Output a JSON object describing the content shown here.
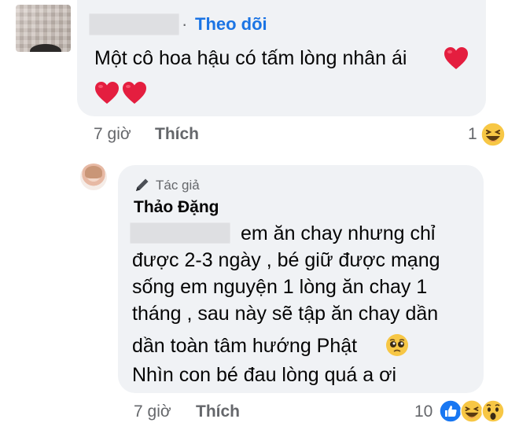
{
  "comment1": {
    "follow_dot": "·",
    "follow_label": "Theo dõi",
    "text": "Một cô hoa hậu có tấm lòng nhân ái",
    "time": "7 giờ",
    "like_label": "Thích",
    "reaction_count": "1"
  },
  "reply": {
    "author_tag": "Tác giả",
    "author_name": "Thảo Đặng",
    "line1": "em ăn chay nhưng chỉ",
    "line2": "được 2-3 ngày , bé giữ được mạng",
    "line3": "sống em nguyện 1 lòng ăn chay 1",
    "line4": "tháng , sau này sẽ tập ăn chay dần",
    "line5": "dần toàn tâm hướng Phật",
    "line6": "Nhìn con bé đau lòng quá a ơi",
    "time": "7 giờ",
    "like_label": "Thích",
    "reaction_count": "10"
  },
  "colors": {
    "bubble": "#f0f2f5",
    "link_blue": "#1b74e4",
    "meta_gray": "#65676b",
    "heart_red": "#e41e3f",
    "like_blue": "#1877f2",
    "emoji_yellow": "#f7c745"
  },
  "icons": [
    "heart-icon",
    "laugh-emoji-icon",
    "like-icon",
    "wow-emoji-icon",
    "pleading-emoji-icon",
    "pen-icon"
  ]
}
